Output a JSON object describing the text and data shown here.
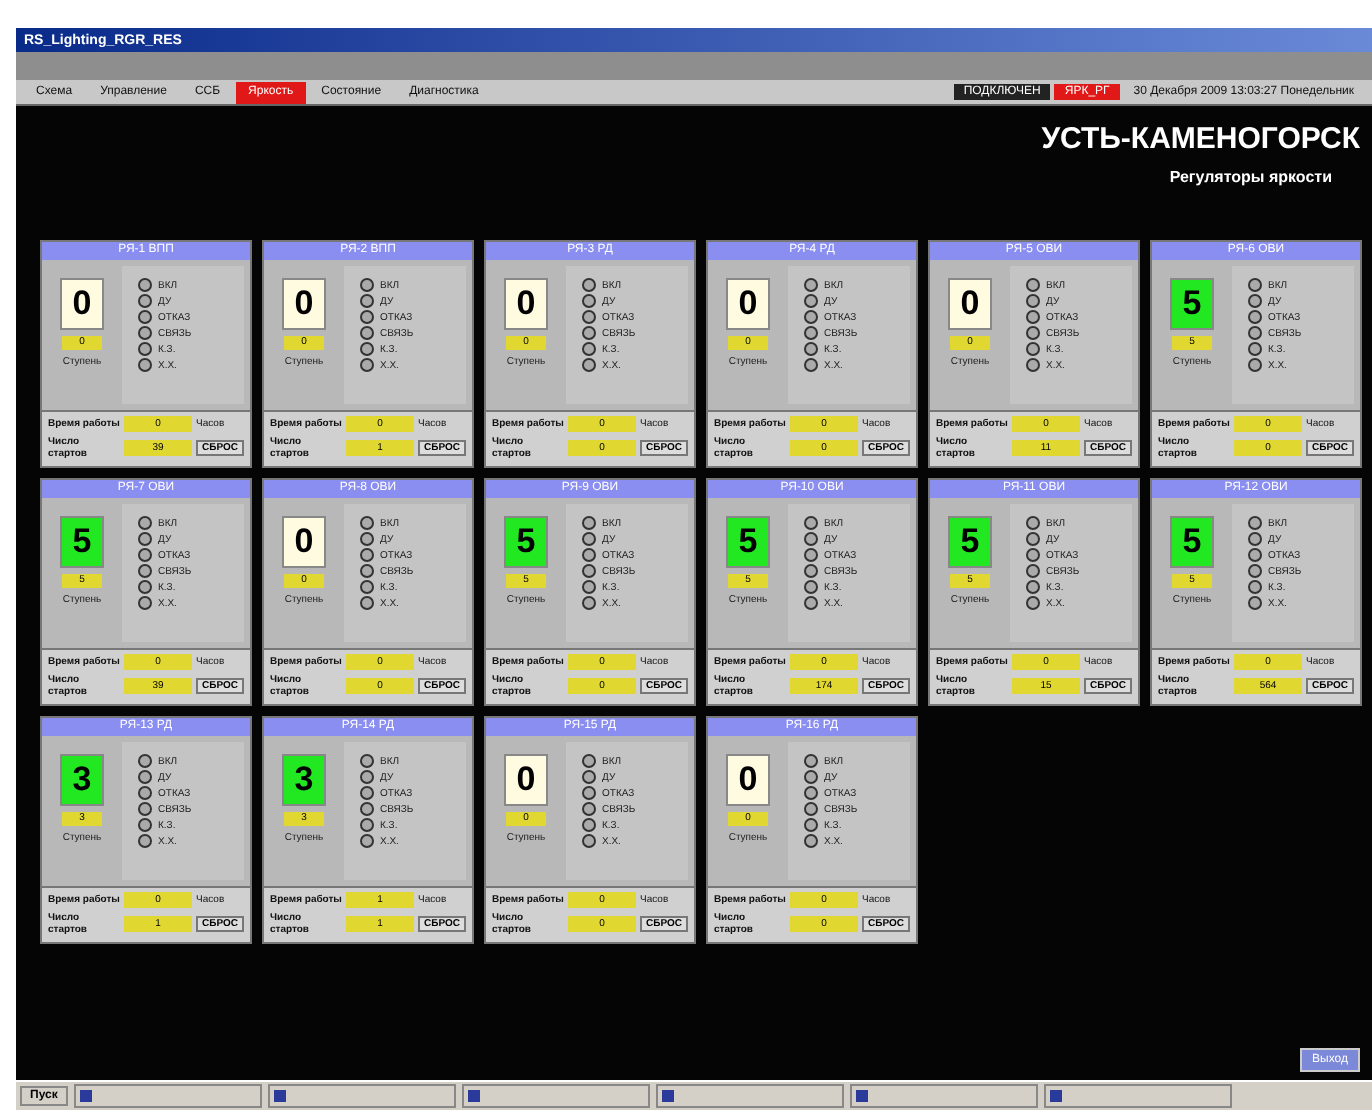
{
  "window": {
    "title": "RS_Lighting_RGR_RES"
  },
  "tabs": [
    {
      "label": "Схема",
      "selected": false
    },
    {
      "label": "Управление",
      "selected": false
    },
    {
      "label": "ССБ",
      "selected": false
    },
    {
      "label": "Яркость",
      "selected": true
    },
    {
      "label": "Состояние",
      "selected": false
    },
    {
      "label": "Диагностика",
      "selected": false
    }
  ],
  "status": [
    {
      "text": "ПОДКЛЮЧЕН",
      "alarm": false
    },
    {
      "text": "ЯРК_РГ",
      "alarm": true
    },
    {
      "text": "30 Декабря 2009  13:03:27 Понедельник",
      "alarm": false
    }
  ],
  "header": {
    "city": "УСТЬ-КАМЕНОГОРСК",
    "subtitle": "Регуляторы яркости"
  },
  "regulators": [
    {
      "title": "РЯ-1 ВПП",
      "value": "0",
      "active": false,
      "step": "0",
      "step_label": "Ступень",
      "legend": [
        "ВКЛ",
        "ДУ",
        "ОТКАЗ",
        "СВЯЗЬ",
        "К.З.",
        "Х.Х."
      ],
      "hours_label": "Время работы",
      "hours": "0",
      "hours_unit": "Часов",
      "starts_label": "Число стартов",
      "starts": "39",
      "reset": "СБРОС"
    },
    {
      "title": "РЯ-2 ВПП",
      "value": "0",
      "active": false,
      "step": "0",
      "step_label": "Ступень",
      "legend": [
        "ВКЛ",
        "ДУ",
        "ОТКАЗ",
        "СВЯЗЬ",
        "К.З.",
        "Х.Х."
      ],
      "hours_label": "Время работы",
      "hours": "0",
      "hours_unit": "Часов",
      "starts_label": "Число стартов",
      "starts": "1",
      "reset": "СБРОС"
    },
    {
      "title": "РЯ-3 РД",
      "value": "0",
      "active": false,
      "step": "0",
      "step_label": "Ступень",
      "legend": [
        "ВКЛ",
        "ДУ",
        "ОТКАЗ",
        "СВЯЗЬ",
        "К.З.",
        "Х.Х."
      ],
      "hours_label": "Время работы",
      "hours": "0",
      "hours_unit": "Часов",
      "starts_label": "Число стартов",
      "starts": "0",
      "reset": "СБРОС"
    },
    {
      "title": "РЯ-4 РД",
      "value": "0",
      "active": false,
      "step": "0",
      "step_label": "Ступень",
      "legend": [
        "ВКЛ",
        "ДУ",
        "ОТКАЗ",
        "СВЯЗЬ",
        "К.З.",
        "Х.Х."
      ],
      "hours_label": "Время работы",
      "hours": "0",
      "hours_unit": "Часов",
      "starts_label": "Число стартов",
      "starts": "0",
      "reset": "СБРОС"
    },
    {
      "title": "РЯ-5 ОВИ",
      "value": "0",
      "active": false,
      "step": "0",
      "step_label": "Ступень",
      "legend": [
        "ВКЛ",
        "ДУ",
        "ОТКАЗ",
        "СВЯЗЬ",
        "К.З.",
        "Х.Х."
      ],
      "hours_label": "Время работы",
      "hours": "0",
      "hours_unit": "Часов",
      "starts_label": "Число стартов",
      "starts": "11",
      "reset": "СБРОС"
    },
    {
      "title": "РЯ-6 ОВИ",
      "value": "5",
      "active": true,
      "step": "5",
      "step_label": "Ступень",
      "legend": [
        "ВКЛ",
        "ДУ",
        "ОТКАЗ",
        "СВЯЗЬ",
        "К.З.",
        "Х.Х."
      ],
      "hours_label": "Время работы",
      "hours": "0",
      "hours_unit": "Часов",
      "starts_label": "Число стартов",
      "starts": "0",
      "reset": "СБРОС"
    },
    {
      "title": "РЯ-7 ОВИ",
      "value": "5",
      "active": true,
      "step": "5",
      "step_label": "Ступень",
      "legend": [
        "ВКЛ",
        "ДУ",
        "ОТКАЗ",
        "СВЯЗЬ",
        "К.З.",
        "Х.Х."
      ],
      "hours_label": "Время работы",
      "hours": "0",
      "hours_unit": "Часов",
      "starts_label": "Число стартов",
      "starts": "39",
      "reset": "СБРОС"
    },
    {
      "title": "РЯ-8 ОВИ",
      "value": "0",
      "active": false,
      "step": "0",
      "step_label": "Ступень",
      "legend": [
        "ВКЛ",
        "ДУ",
        "ОТКАЗ",
        "СВЯЗЬ",
        "К.З.",
        "Х.Х."
      ],
      "hours_label": "Время работы",
      "hours": "0",
      "hours_unit": "Часов",
      "starts_label": "Число стартов",
      "starts": "0",
      "reset": "СБРОС"
    },
    {
      "title": "РЯ-9 ОВИ",
      "value": "5",
      "active": true,
      "step": "5",
      "step_label": "Ступень",
      "legend": [
        "ВКЛ",
        "ДУ",
        "ОТКАЗ",
        "СВЯЗЬ",
        "К.З.",
        "Х.Х."
      ],
      "hours_label": "Время работы",
      "hours": "0",
      "hours_unit": "Часов",
      "starts_label": "Число стартов",
      "starts": "0",
      "reset": "СБРОС"
    },
    {
      "title": "РЯ-10 ОВИ",
      "value": "5",
      "active": true,
      "step": "5",
      "step_label": "Ступень",
      "legend": [
        "ВКЛ",
        "ДУ",
        "ОТКАЗ",
        "СВЯЗЬ",
        "К.З.",
        "Х.Х."
      ],
      "hours_label": "Время работы",
      "hours": "0",
      "hours_unit": "Часов",
      "starts_label": "Число стартов",
      "starts": "174",
      "reset": "СБРОС"
    },
    {
      "title": "РЯ-11 ОВИ",
      "value": "5",
      "active": true,
      "step": "5",
      "step_label": "Ступень",
      "legend": [
        "ВКЛ",
        "ДУ",
        "ОТКАЗ",
        "СВЯЗЬ",
        "К.З.",
        "Х.Х."
      ],
      "hours_label": "Время работы",
      "hours": "0",
      "hours_unit": "Часов",
      "starts_label": "Число стартов",
      "starts": "15",
      "reset": "СБРОС"
    },
    {
      "title": "РЯ-12 ОВИ",
      "value": "5",
      "active": true,
      "step": "5",
      "step_label": "Ступень",
      "legend": [
        "ВКЛ",
        "ДУ",
        "ОТКАЗ",
        "СВЯЗЬ",
        "К.З.",
        "Х.Х."
      ],
      "hours_label": "Время работы",
      "hours": "0",
      "hours_unit": "Часов",
      "starts_label": "Число стартов",
      "starts": "564",
      "reset": "СБРОС"
    },
    {
      "title": "РЯ-13 РД",
      "value": "3",
      "active": true,
      "step": "3",
      "step_label": "Ступень",
      "legend": [
        "ВКЛ",
        "ДУ",
        "ОТКАЗ",
        "СВЯЗЬ",
        "К.З.",
        "Х.Х."
      ],
      "hours_label": "Время работы",
      "hours": "0",
      "hours_unit": "Часов",
      "starts_label": "Число стартов",
      "starts": "1",
      "reset": "СБРОС"
    },
    {
      "title": "РЯ-14 РД",
      "value": "3",
      "active": true,
      "step": "3",
      "step_label": "Ступень",
      "legend": [
        "ВКЛ",
        "ДУ",
        "ОТКАЗ",
        "СВЯЗЬ",
        "К.З.",
        "Х.Х."
      ],
      "hours_label": "Время работы",
      "hours": "1",
      "hours_unit": "Часов",
      "starts_label": "Число стартов",
      "starts": "1",
      "reset": "СБРОС"
    },
    {
      "title": "РЯ-15 РД",
      "value": "0",
      "active": false,
      "step": "0",
      "step_label": "Ступень",
      "legend": [
        "ВКЛ",
        "ДУ",
        "ОТКАЗ",
        "СВЯЗЬ",
        "К.З.",
        "Х.Х."
      ],
      "hours_label": "Время работы",
      "hours": "0",
      "hours_unit": "Часов",
      "starts_label": "Число стартов",
      "starts": "0",
      "reset": "СБРОС"
    },
    {
      "title": "РЯ-16 РД",
      "value": "0",
      "active": false,
      "step": "0",
      "step_label": "Ступень",
      "legend": [
        "ВКЛ",
        "ДУ",
        "ОТКАЗ",
        "СВЯЗЬ",
        "К.З.",
        "Х.Х."
      ],
      "hours_label": "Время работы",
      "hours": "0",
      "hours_unit": "Часов",
      "starts_label": "Число стартов",
      "starts": "0",
      "reset": "СБРОС"
    }
  ],
  "exit_button": "Выход",
  "taskbar": {
    "start": "Пуск"
  }
}
